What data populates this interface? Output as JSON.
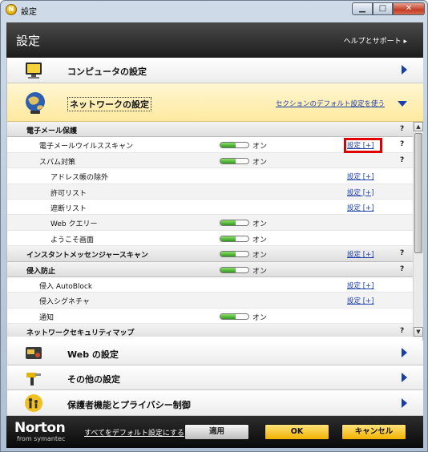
{
  "window": {
    "title": "設定",
    "app_icon_glyph": "N"
  },
  "header": {
    "title": "設定",
    "help_link": "ヘルプとサポート ▸"
  },
  "categories": {
    "computer": {
      "label": "コンピュータの設定",
      "icon": "monitor-icon"
    },
    "network": {
      "label": "ネットワークの設定",
      "default_link": "セクションのデフォルト設定を使う",
      "icon": "globe-icon"
    },
    "web": {
      "label": "Web の設定",
      "icon": "card-icon"
    },
    "other": {
      "label": "その他の設定",
      "icon": "tools-icon"
    },
    "parental": {
      "label": "保護者機能とプライバシー制御",
      "icon": "family-icon"
    }
  },
  "settings": {
    "email_protection": {
      "label": "電子メール保護"
    },
    "email_virus_scan": {
      "label": "電子メールウイルススキャン",
      "toggle": "オン",
      "link": "設定 [+]"
    },
    "antispam": {
      "label": "スパム対策",
      "toggle": "オン"
    },
    "address_exclusion": {
      "label": "アドレス帳の除外",
      "link": "設定 [+]"
    },
    "allow_list": {
      "label": "許可リスト",
      "link": "設定 [+]"
    },
    "block_list": {
      "label": "遮断リスト",
      "link": "設定 [+]"
    },
    "web_query": {
      "label": "Web クエリー",
      "toggle": "オン"
    },
    "welcome_screen": {
      "label": "ようこそ画面",
      "toggle": "オン"
    },
    "im_scan": {
      "label": "インスタントメッセンジャースキャン",
      "toggle": "オン",
      "link": "設定 [+]"
    },
    "intrusion_prevention": {
      "label": "侵入防止",
      "toggle": "オン"
    },
    "auto_block": {
      "label": "侵入 AutoBlock",
      "link": "設定 [+]"
    },
    "intrusion_signatures": {
      "label": "侵入シグネチャ",
      "link": "設定 [+]"
    },
    "notification": {
      "label": "通知",
      "toggle": "オン"
    },
    "network_security_map": {
      "label": "ネットワークセキュリティマップ"
    }
  },
  "help_glyph": "?",
  "footer": {
    "logo": "Norton",
    "logo_sub": "from symantec",
    "default_link": "すべてをデフォルト設定にする",
    "apply": "適用",
    "ok": "OK",
    "cancel": "キャンセル"
  },
  "colors": {
    "accent_link": "#1b3fa8",
    "toggle_on": "#2f9a1e",
    "highlight": "#e00000",
    "ok_button": "#f2b100"
  }
}
